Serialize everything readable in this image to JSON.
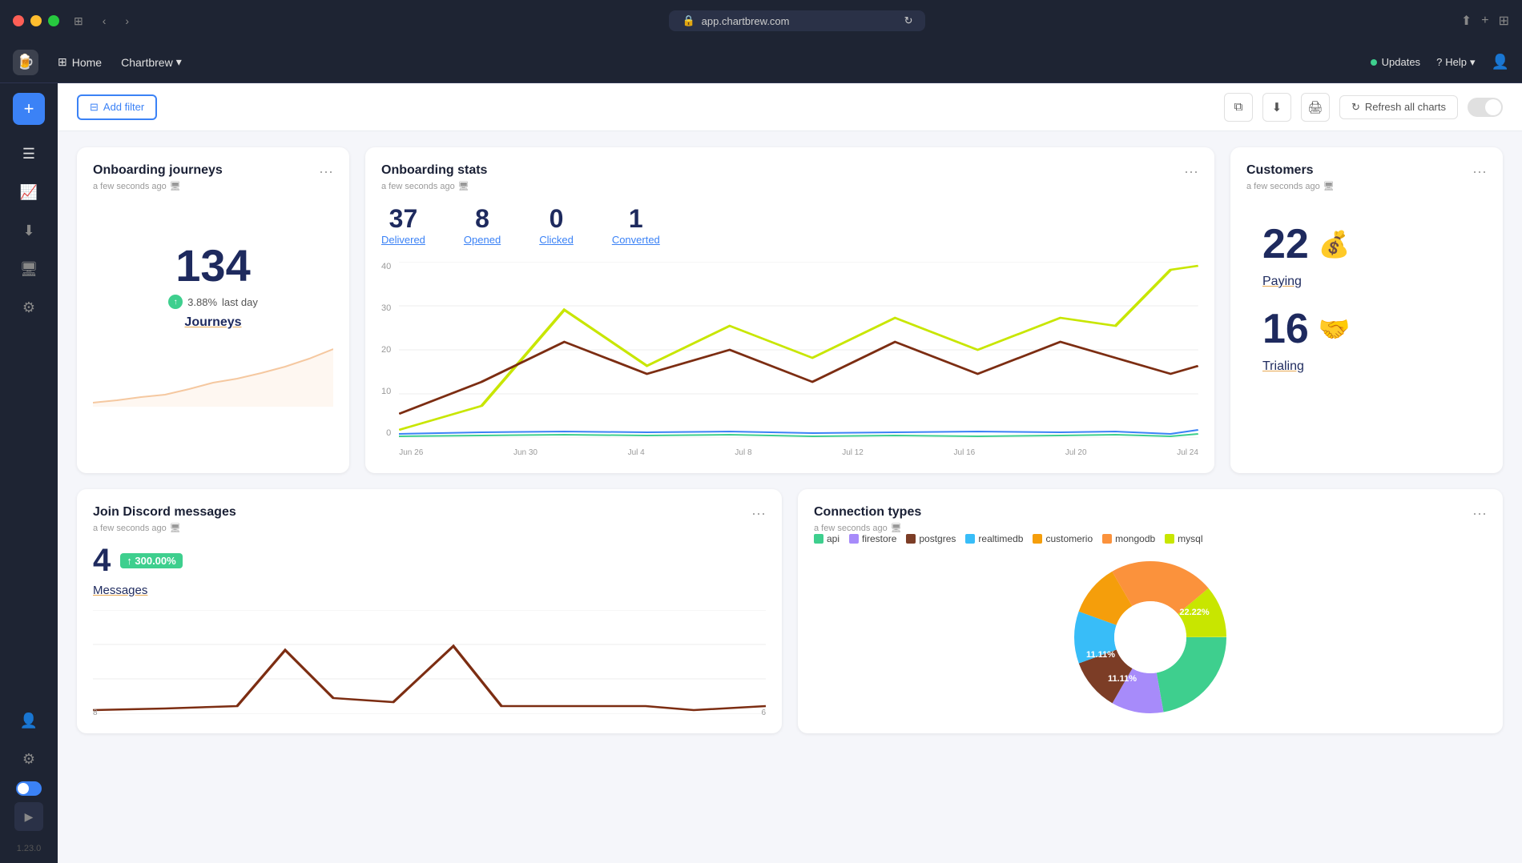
{
  "titlebar": {
    "address": "app.chartbrew.com",
    "back_label": "‹",
    "forward_label": "›"
  },
  "navbar": {
    "logo": "🍺",
    "home_label": "Home",
    "brand_label": "Chartbrew",
    "updates_label": "Updates",
    "help_label": "Help"
  },
  "toolbar": {
    "filter_label": "Add filter",
    "refresh_label": "Refresh all charts"
  },
  "sidebar": {
    "version": "1.23.0"
  },
  "onboarding_journeys": {
    "title": "Onboarding journeys",
    "timestamp": "a few seconds ago",
    "big_number": "134",
    "growth_pct": "3.88%",
    "growth_suffix": "last day",
    "journeys_label": "Journeys"
  },
  "onboarding_stats": {
    "title": "Onboarding stats",
    "timestamp": "a few seconds ago",
    "delivered": "37",
    "opened": "8",
    "clicked": "0",
    "converted": "1",
    "delivered_label": "Delivered",
    "opened_label": "Opened",
    "clicked_label": "Clicked",
    "converted_label": "Converted"
  },
  "customers": {
    "title": "Customers",
    "timestamp": "a few seconds ago",
    "paying_num": "22",
    "paying_emoji": "💰",
    "paying_label": "Paying",
    "trialing_num": "16",
    "trialing_emoji": "🤝",
    "trialing_label": "Trialing"
  },
  "discord": {
    "title": "Join Discord messages",
    "timestamp": "a few seconds ago",
    "big_number": "4",
    "growth_pct": "300.00%",
    "messages_label": "Messages"
  },
  "connection_types": {
    "title": "Connection types",
    "timestamp": "a few seconds ago",
    "legend": [
      {
        "name": "api",
        "color": "#3ecf8e"
      },
      {
        "name": "firestore",
        "color": "#a78bfa"
      },
      {
        "name": "postgres",
        "color": "#7c3d26"
      },
      {
        "name": "realtimedb",
        "color": "#38bdf8"
      },
      {
        "name": "customerio",
        "color": "#f59e0b"
      },
      {
        "name": "mongodb",
        "color": "#fb923c"
      },
      {
        "name": "mysql",
        "color": "#c8e600"
      }
    ],
    "segments": [
      {
        "label": "22.22%",
        "color": "#3ecf8e",
        "pct": 22.22
      },
      {
        "label": "11.11%",
        "color": "#a78bfa",
        "pct": 11.11
      },
      {
        "label": "11.11%",
        "color": "#7c3d26",
        "pct": 11.11
      },
      {
        "label": "11.11%",
        "color": "#38bdf8",
        "pct": 11.11
      },
      {
        "label": "",
        "color": "#f59e0b",
        "pct": 11.11
      },
      {
        "label": "",
        "color": "#fb923c",
        "pct": 22.22
      },
      {
        "label": "",
        "color": "#c8e600",
        "pct": 11.11
      }
    ]
  },
  "chart_yaxis": [
    "40",
    "30",
    "20",
    "10",
    "0"
  ],
  "chart_xaxis": [
    "Jun 26",
    "Jun 30",
    "Jul 4",
    "Jul 8",
    "Jul 12",
    "Jul 16",
    "Jul 20",
    "Jul 24"
  ]
}
